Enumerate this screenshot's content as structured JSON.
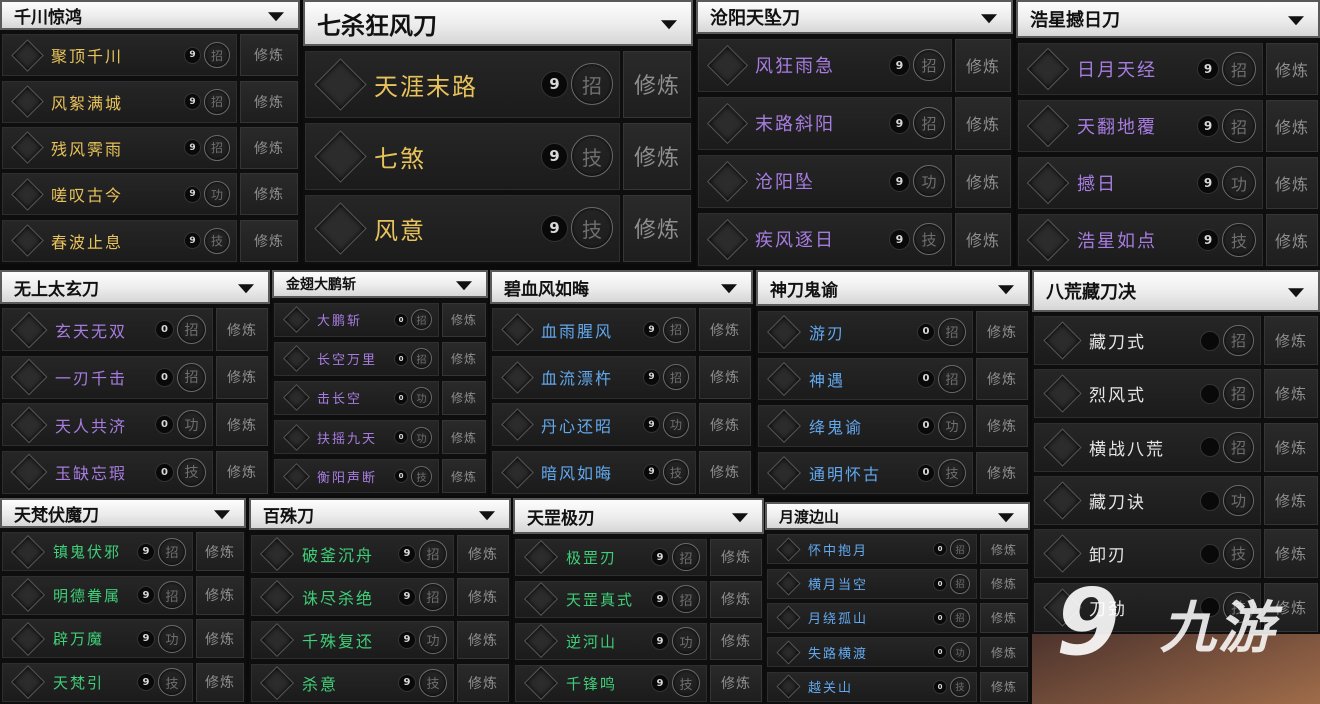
{
  "action_label": "修炼",
  "panels": [
    {
      "title": "千川惊鸿",
      "color": "gold",
      "skills": [
        {
          "name": "聚顶千川",
          "level": "9",
          "type": "招"
        },
        {
          "name": "风絮满城",
          "level": "9",
          "type": "招"
        },
        {
          "name": "残风霁雨",
          "level": "9",
          "type": "招"
        },
        {
          "name": "嗟叹古今",
          "level": "9",
          "type": "功"
        },
        {
          "name": "春波止息",
          "level": "9",
          "type": "技"
        }
      ]
    },
    {
      "title": "七杀狂风刀",
      "color": "gold",
      "skills": [
        {
          "name": "天涯末路",
          "level": "9",
          "type": "招"
        },
        {
          "name": "七煞",
          "level": "9",
          "type": "技"
        },
        {
          "name": "风意",
          "level": "9",
          "type": "技"
        }
      ]
    },
    {
      "title": "沧阳天坠刀",
      "color": "purple",
      "skills": [
        {
          "name": "风狂雨急",
          "level": "9",
          "type": "招"
        },
        {
          "name": "末路斜阳",
          "level": "9",
          "type": "招"
        },
        {
          "name": "沧阳坠",
          "level": "9",
          "type": "功"
        },
        {
          "name": "疾风逐日",
          "level": "9",
          "type": "技"
        }
      ]
    },
    {
      "title": "浩星撼日刀",
      "color": "purple",
      "skills": [
        {
          "name": "日月天经",
          "level": "9",
          "type": "招"
        },
        {
          "name": "天翻地覆",
          "level": "9",
          "type": "招"
        },
        {
          "name": "撼日",
          "level": "9",
          "type": "功"
        },
        {
          "name": "浩星如点",
          "level": "9",
          "type": "技"
        }
      ]
    },
    {
      "title": "无上太玄刀",
      "color": "purple",
      "skills": [
        {
          "name": "玄天无双",
          "level": "0",
          "type": "招"
        },
        {
          "name": "一刃千击",
          "level": "0",
          "type": "招"
        },
        {
          "name": "天人共济",
          "level": "0",
          "type": "功"
        },
        {
          "name": "玉缺忘瑕",
          "level": "0",
          "type": "技"
        }
      ]
    },
    {
      "title": "金翅大鹏斩",
      "color": "purple",
      "skills": [
        {
          "name": "大鹏斩",
          "level": "0",
          "type": "招"
        },
        {
          "name": "长空万里",
          "level": "0",
          "type": "招"
        },
        {
          "name": "击长空",
          "level": "0",
          "type": "功"
        },
        {
          "name": "扶摇九天",
          "level": "0",
          "type": "功"
        },
        {
          "name": "衡阳声断",
          "level": "0",
          "type": "技"
        }
      ]
    },
    {
      "title": "碧血风如晦",
      "color": "blue",
      "skills": [
        {
          "name": "血雨腥风",
          "level": "9",
          "type": "招"
        },
        {
          "name": "血流漂杵",
          "level": "9",
          "type": "招"
        },
        {
          "name": "丹心还昭",
          "level": "9",
          "type": "功"
        },
        {
          "name": "暗风如晦",
          "level": "9",
          "type": "技"
        }
      ]
    },
    {
      "title": "神刀鬼谕",
      "color": "blue",
      "skills": [
        {
          "name": "游刃",
          "level": "0",
          "type": "招"
        },
        {
          "name": "神遇",
          "level": "0",
          "type": "招"
        },
        {
          "name": "绛鬼谕",
          "level": "0",
          "type": "功"
        },
        {
          "name": "通明怀古",
          "level": "0",
          "type": "技"
        }
      ]
    },
    {
      "title": "八荒藏刀决",
      "color": "white",
      "skills": [
        {
          "name": "藏刀式",
          "level": "",
          "type": "招"
        },
        {
          "name": "烈风式",
          "level": "",
          "type": "招"
        },
        {
          "name": "横战八荒",
          "level": "",
          "type": "招"
        },
        {
          "name": "藏刀诀",
          "level": "",
          "type": "功"
        },
        {
          "name": "卸刃",
          "level": "",
          "type": "技"
        },
        {
          "name": "刀劲",
          "level": "",
          "type": "技"
        }
      ]
    },
    {
      "title": "天梵伏魔刀",
      "color": "green",
      "skills": [
        {
          "name": "镇鬼伏邪",
          "level": "9",
          "type": "招"
        },
        {
          "name": "明德眷属",
          "level": "9",
          "type": "招"
        },
        {
          "name": "辟万魔",
          "level": "9",
          "type": "功"
        },
        {
          "name": "天梵引",
          "level": "9",
          "type": "技"
        }
      ]
    },
    {
      "title": "百殊刀",
      "color": "green",
      "skills": [
        {
          "name": "破釜沉舟",
          "level": "9",
          "type": "招"
        },
        {
          "name": "诛尽杀绝",
          "level": "9",
          "type": "招"
        },
        {
          "name": "千殊复还",
          "level": "9",
          "type": "功"
        },
        {
          "name": "杀意",
          "level": "9",
          "type": "技"
        }
      ]
    },
    {
      "title": "天罡极刃",
      "color": "green",
      "skills": [
        {
          "name": "极罡刃",
          "level": "9",
          "type": "招"
        },
        {
          "name": "天罡真式",
          "level": "9",
          "type": "招"
        },
        {
          "name": "逆河山",
          "level": "9",
          "type": "功"
        },
        {
          "name": "千锋鸣",
          "level": "9",
          "type": "技"
        }
      ]
    },
    {
      "title": "月渡边山",
      "color": "blue",
      "skills": [
        {
          "name": "怀中抱月",
          "level": "0",
          "type": "招"
        },
        {
          "name": "横月当空",
          "level": "0",
          "type": "招"
        },
        {
          "name": "月绕孤山",
          "level": "0",
          "type": "招"
        },
        {
          "name": "失路横渡",
          "level": "0",
          "type": "功"
        },
        {
          "name": "越关山",
          "level": "0",
          "type": "技"
        }
      ]
    }
  ],
  "watermark": {
    "number": "9",
    "text": "九游"
  }
}
